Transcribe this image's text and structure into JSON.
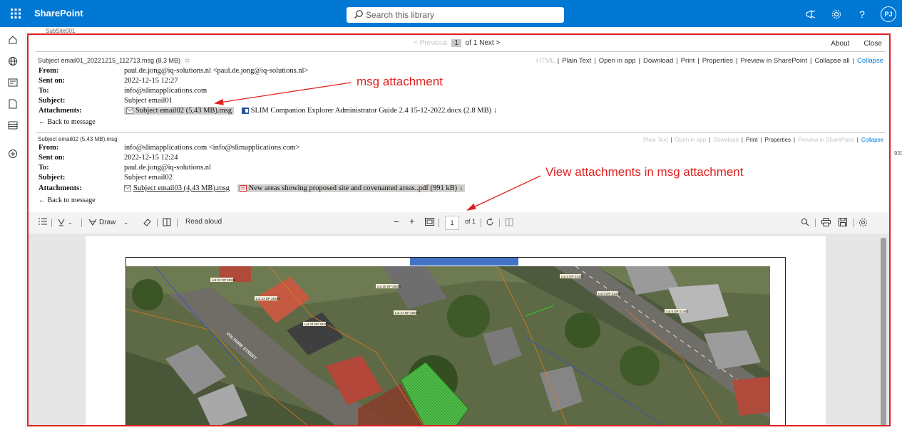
{
  "suite": {
    "brand": "SharePoint",
    "search_placeholder": "Search this library",
    "avatar_initials": "PJ"
  },
  "site": {
    "name": "SubSite001"
  },
  "pager": {
    "previous": "< Previous",
    "page": "1",
    "of_next": "of 1 Next >"
  },
  "top_links": {
    "about": "About",
    "close": "Close"
  },
  "message1": {
    "title": "Subject email01_20221215_112713.msg (8.3 MB)",
    "actions": {
      "html": "HTML",
      "plain_text": "Plain Text",
      "open_in_app": "Open in app",
      "download": "Download",
      "print": "Print",
      "properties": "Properties",
      "preview": "Preview in SharePoint",
      "collapse_all": "Collapse all",
      "collapse": "Collapse"
    },
    "labels": {
      "from": "From:",
      "sent": "Sent on:",
      "to": "To:",
      "subject": "Subject:",
      "attachments": "Attachments:"
    },
    "from": "paul.de.jong@iq-solutions.nl <paul.de.jong@iq-solutions.nl>",
    "sent": "2022-12-15 12:27",
    "to": "info@slimapplications.com",
    "subject": "Subject email01",
    "attachments": [
      {
        "name": "Subject email02 (5,43 MB).msg"
      },
      {
        "name": "SLIM Companion Explorer Administrator Guide 2.4 15-12-2022.docx (2.8 MB)"
      }
    ],
    "back": "← Back to message"
  },
  "message2": {
    "title": "Subject email02 (5,43 MB).msg",
    "actions": {
      "plain_text": "Plain Text",
      "open_in_app": "Open in app",
      "download": "Download",
      "print": "Print",
      "properties": "Properties",
      "preview": "Preview in SharePoint",
      "collapse": "Collapse"
    },
    "labels": {
      "from": "From:",
      "sent": "Sent on:",
      "to": "To:",
      "subject": "Subject:",
      "attachments": "Attachments:"
    },
    "from": "info@slimapplications.com <info@slimapplications.com>",
    "sent": "2022-12-15 12:24",
    "to": "paul.de.jong@iq-solutions.nl",
    "subject": "Subject email02",
    "attachments": [
      {
        "name": "Subject email03 (4,43 MB).msg"
      },
      {
        "name": "New areas showing proposed site and covenanted areas..pdf (991 kB)"
      }
    ],
    "back": "← Back to message"
  },
  "annotations": {
    "msg_attachment": "msg attachment",
    "view_attachments": "View attachments in msg attachment"
  },
  "pdf_toolbar": {
    "draw": "Draw",
    "read_aloud": "Read aloud",
    "page": "1",
    "of_pages": "of 1"
  },
  "map_labels": [
    "Lot 22 DP 28394",
    "Lot 23 DP 28394",
    "Lot 24 DP 28394",
    "Lot 26 DP 28394",
    "Lot 27 DP 28394",
    "Lot 3 DP 21440",
    "Lot 4 DP 21440",
    "Lot 5 DP 21440",
    "VOLTAIRE STREET"
  ],
  "edge_text": "933",
  "colors": {
    "suite": "#0078d4",
    "annotation": "#e0201f",
    "accent": "#0078d4"
  },
  "icons": [
    "app-launcher-icon",
    "search-icon",
    "megaphone-icon",
    "gear-icon",
    "help-icon",
    "home-icon",
    "globe-icon",
    "news-icon",
    "file-icon",
    "list-icon",
    "add-icon",
    "star-icon"
  ]
}
